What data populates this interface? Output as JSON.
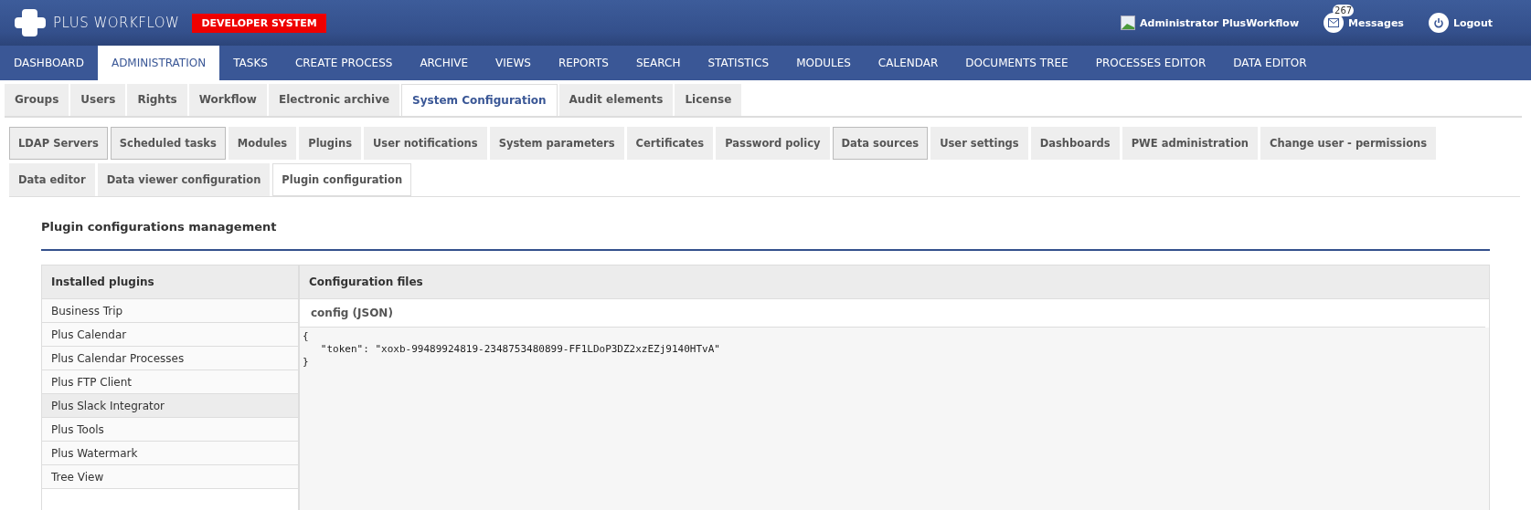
{
  "header": {
    "logo_text": "PLUS WORKFLOW",
    "environment_badge": "DEVELOPER SYSTEM",
    "user": "Administrator PlusWorkflow",
    "messages_count": "267",
    "messages_label": "Messages",
    "logout_label": "Logout"
  },
  "main_nav": [
    {
      "label": "DASHBOARD",
      "selected": false
    },
    {
      "label": "ADMINISTRATION",
      "selected": true
    },
    {
      "label": "TASKS",
      "selected": false
    },
    {
      "label": "CREATE PROCESS",
      "selected": false
    },
    {
      "label": "ARCHIVE",
      "selected": false
    },
    {
      "label": "VIEWS",
      "selected": false
    },
    {
      "label": "REPORTS",
      "selected": false
    },
    {
      "label": "SEARCH",
      "selected": false
    },
    {
      "label": "STATISTICS",
      "selected": false
    },
    {
      "label": "MODULES",
      "selected": false
    },
    {
      "label": "CALENDAR",
      "selected": false
    },
    {
      "label": "DOCUMENTS TREE",
      "selected": false
    },
    {
      "label": "PROCESSES EDITOR",
      "selected": false
    },
    {
      "label": "DATA EDITOR",
      "selected": false
    }
  ],
  "admin_tabs": [
    {
      "label": "Groups",
      "selected": false
    },
    {
      "label": "Users",
      "selected": false
    },
    {
      "label": "Rights",
      "selected": false
    },
    {
      "label": "Workflow",
      "selected": false
    },
    {
      "label": "Electronic archive",
      "selected": false
    },
    {
      "label": "System Configuration",
      "selected": true
    },
    {
      "label": "Audit elements",
      "selected": false
    },
    {
      "label": "License",
      "selected": false
    }
  ],
  "config_tabs": [
    {
      "label": "LDAP Servers",
      "selected": false,
      "outlined": true
    },
    {
      "label": "Scheduled tasks",
      "selected": false,
      "outlined": true
    },
    {
      "label": "Modules",
      "selected": false,
      "outlined": false
    },
    {
      "label": "Plugins",
      "selected": false,
      "outlined": false
    },
    {
      "label": "User notifications",
      "selected": false,
      "outlined": false
    },
    {
      "label": "System parameters",
      "selected": false,
      "outlined": false
    },
    {
      "label": "Certificates",
      "selected": false,
      "outlined": false
    },
    {
      "label": "Password policy",
      "selected": false,
      "outlined": false
    },
    {
      "label": "Data sources",
      "selected": false,
      "outlined": true
    },
    {
      "label": "User settings",
      "selected": false,
      "outlined": false
    },
    {
      "label": "Dashboards",
      "selected": false,
      "outlined": false
    },
    {
      "label": "PWE administration",
      "selected": false,
      "outlined": false
    },
    {
      "label": "Change user - permissions",
      "selected": false,
      "outlined": false
    },
    {
      "label": "Data editor",
      "selected": false,
      "outlined": false
    },
    {
      "label": "Data viewer configuration",
      "selected": false,
      "outlined": false
    },
    {
      "label": "Plugin configuration",
      "selected": true,
      "outlined": false
    }
  ],
  "section_title": "Plugin configurations management",
  "plugins": {
    "heading": "Installed plugins",
    "items": [
      {
        "label": "Business Trip",
        "selected": false
      },
      {
        "label": "Plus Calendar",
        "selected": false
      },
      {
        "label": "Plus Calendar Processes",
        "selected": false
      },
      {
        "label": "Plus FTP Client",
        "selected": false
      },
      {
        "label": "Plus Slack Integrator",
        "selected": true
      },
      {
        "label": "Plus Tools",
        "selected": false
      },
      {
        "label": "Plus Watermark",
        "selected": false
      },
      {
        "label": "Tree View",
        "selected": false
      }
    ]
  },
  "config_files": {
    "heading": "Configuration files",
    "file_name": "config (JSON)",
    "editor_lines": [
      "{",
      "   \"token\": \"xoxb-99489924819-2348753480899-FF1LDoP3DZ2xzEZj9140HTvA\"",
      "}"
    ]
  }
}
